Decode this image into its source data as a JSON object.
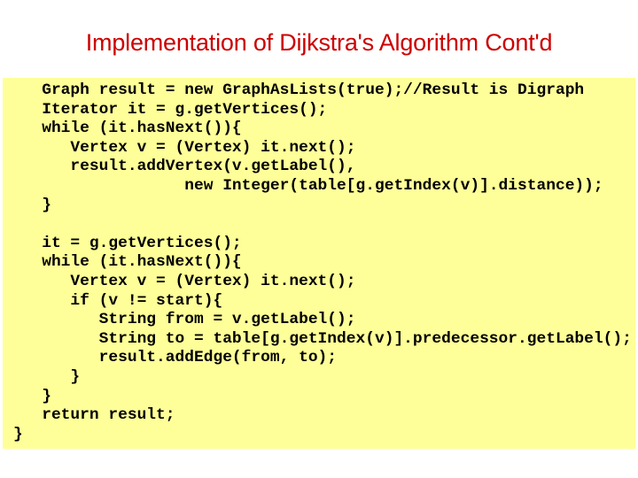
{
  "slide": {
    "title": "Implementation of Dijkstra's Algorithm Cont'd",
    "title_color": "#cc0000",
    "code_background": "#ffff99",
    "code_lines": [
      "   Graph result = new GraphAsLists(true);//Result is Digraph",
      "   Iterator it = g.getVertices();",
      "   while (it.hasNext()){",
      "      Vertex v = (Vertex) it.next();",
      "      result.addVertex(v.getLabel(),",
      "                  new Integer(table[g.getIndex(v)].distance));",
      "   }",
      "",
      "   it = g.getVertices();",
      "   while (it.hasNext()){",
      "      Vertex v = (Vertex) it.next();",
      "      if (v != start){",
      "         String from = v.getLabel();",
      "         String to = table[g.getIndex(v)].predecessor.getLabel();",
      "         result.addEdge(from, to);",
      "      }",
      "   }",
      "   return result;",
      "}"
    ]
  }
}
